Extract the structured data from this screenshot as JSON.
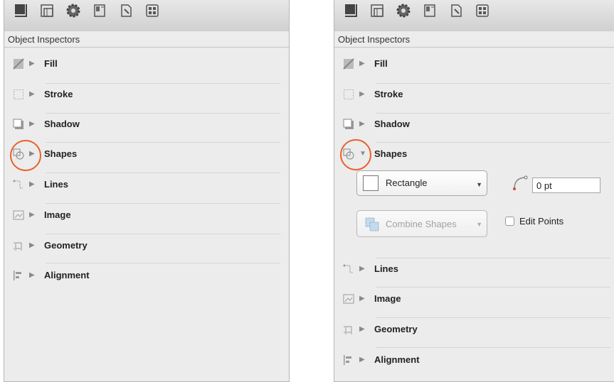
{
  "title": "Object Inspectors",
  "toolbar_icons": [
    "canvas-inspector-icon",
    "layer-inspector-icon",
    "gear-inspector-icon",
    "properties-inspector-icon",
    "document-inspector-icon",
    "grid-inspector-icon"
  ],
  "sections": {
    "fill": "Fill",
    "stroke": "Stroke",
    "shadow": "Shadow",
    "shapes": "Shapes",
    "lines": "Lines",
    "image": "Image",
    "geometry": "Geometry",
    "alignment": "Alignment"
  },
  "shapes_panel": {
    "shape_popup": "Rectangle",
    "corner_radius": "0 pt",
    "combine_button": "Combine Shapes",
    "edit_points": "Edit Points",
    "edit_points_checked": false
  },
  "colors": {
    "highlight": "#ec5f2a"
  }
}
